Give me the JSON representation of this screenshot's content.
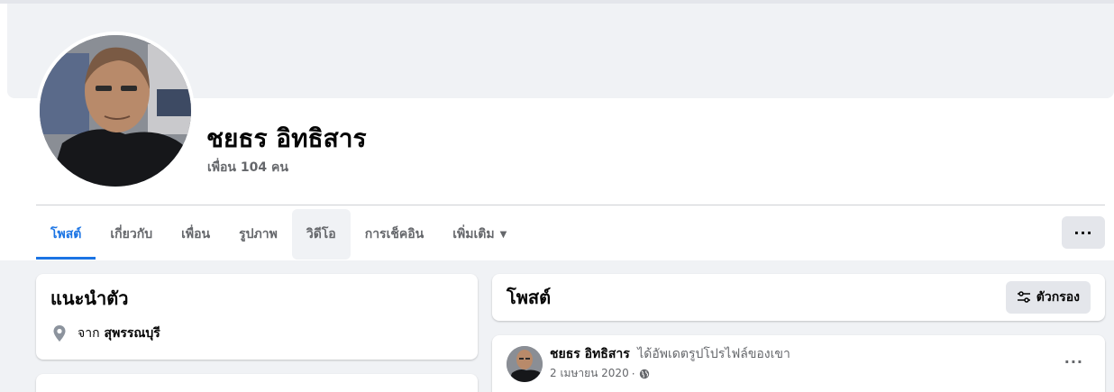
{
  "profile": {
    "name": "ชยธร อิทธิสาร",
    "friends": "เพื่อน 104 คน"
  },
  "tabs": [
    {
      "label": "โพสต์",
      "active": true
    },
    {
      "label": "เกี่ยวกับ"
    },
    {
      "label": "เพื่อน"
    },
    {
      "label": "รูปภาพ"
    },
    {
      "label": "วิดีโอ"
    },
    {
      "label": "การเช็คอิน"
    },
    {
      "label": "เพิ่มเติม"
    }
  ],
  "more_button": {
    "label": "···",
    "icon": "more-horizontal-icon"
  },
  "intro": {
    "title": "แนะนำตัว",
    "from_prefix": "จาก",
    "place": "สุพรรณบุรี",
    "icon": "location-pin-icon"
  },
  "posts": {
    "title": "โพสต์",
    "filter_label": "ตัวกรอง",
    "filter_icon": "filter-sliders-icon"
  },
  "post": {
    "author": "ชยธร อิทธิสาร",
    "action": "ได้อัพเดตรูปโปรไฟล์ของเขา",
    "date": "2 เมษายน 2020",
    "separator": "·",
    "privacy_icon": "globe-icon",
    "more": "···"
  },
  "colors": {
    "accent": "#1b74e4",
    "background": "#f0f2f5",
    "secondary_text": "#65676b"
  }
}
